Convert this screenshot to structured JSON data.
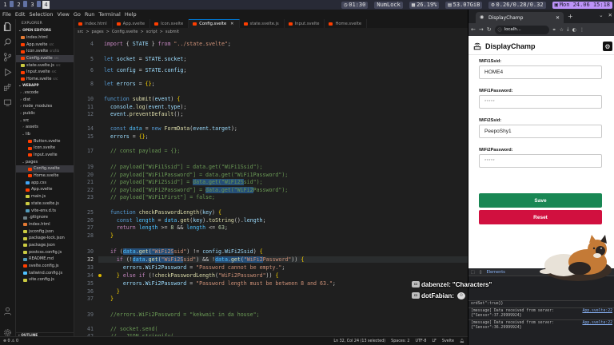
{
  "system_bar": {
    "workspaces": [
      "1",
      "2",
      "3",
      "4"
    ],
    "active_workspace": "4",
    "time_utc": "01:30",
    "numlock": "NumLock",
    "cpu": "26.19%",
    "disk": "53.07GiB",
    "load": "0.26/0.28/0.32",
    "clock": "Mon 24.06 15:18"
  },
  "vscode": {
    "menu": [
      "File",
      "Edit",
      "Selection",
      "View",
      "Go",
      "Run",
      "Terminal",
      "Help"
    ],
    "explorer": {
      "title": "EXPLORER",
      "open_editors_title": "OPEN EDITORS",
      "open_editors": [
        {
          "name": "index.html",
          "path": "",
          "color": "#e37933"
        },
        {
          "name": "App.svelte",
          "path": "src",
          "color": "#ff3e00"
        },
        {
          "name": "Icon.svelte",
          "path": "src/lib",
          "color": "#ff3e00"
        },
        {
          "name": "Config.svelte",
          "path": "src",
          "color": "#ff3e00",
          "selected": true
        },
        {
          "name": "state.svelte.js",
          "path": "src",
          "color": "#cbcb41"
        },
        {
          "name": "Input.svelte",
          "path": "src",
          "color": "#ff3e00"
        },
        {
          "name": "Home.svelte",
          "path": "src",
          "color": "#ff3e00"
        }
      ],
      "project_title": "WEBAPP",
      "tree": [
        {
          "name": ".vscode",
          "indent": 1,
          "folder": true
        },
        {
          "name": "dist",
          "indent": 1,
          "folder": true
        },
        {
          "name": "node_modules",
          "indent": 1,
          "folder": true
        },
        {
          "name": "public",
          "indent": 1,
          "folder": true
        },
        {
          "name": "src",
          "indent": 1,
          "folder": true,
          "open": true
        },
        {
          "name": "assets",
          "indent": 2,
          "folder": true
        },
        {
          "name": "lib",
          "indent": 2,
          "folder": true,
          "open": true
        },
        {
          "name": "Button.svelte",
          "indent": 3,
          "color": "#ff3e00"
        },
        {
          "name": "Icon.svelte",
          "indent": 3,
          "color": "#ff3e00"
        },
        {
          "name": "Input.svelte",
          "indent": 3,
          "color": "#ff3e00"
        },
        {
          "name": "pages",
          "indent": 2,
          "folder": true,
          "open": true
        },
        {
          "name": "Config.svelte",
          "indent": 3,
          "color": "#ff3e00",
          "selected": true
        },
        {
          "name": "Home.svelte",
          "indent": 3,
          "color": "#ff3e00"
        },
        {
          "name": "app.css",
          "indent": 2,
          "color": "#42a5f5"
        },
        {
          "name": "App.svelte",
          "indent": 2,
          "color": "#ff3e00"
        },
        {
          "name": "main.js",
          "indent": 2,
          "color": "#cbcb41"
        },
        {
          "name": "state.svelte.js",
          "indent": 2,
          "color": "#cbcb41"
        },
        {
          "name": "vite-env.d.ts",
          "indent": 2,
          "color": "#519aba"
        },
        {
          "name": ".gitignore",
          "indent": 1,
          "color": "#6d8086"
        },
        {
          "name": "index.html",
          "indent": 1,
          "color": "#e37933"
        },
        {
          "name": "jsconfig.json",
          "indent": 1,
          "color": "#cbcb41"
        },
        {
          "name": "package-lock.json",
          "indent": 1,
          "color": "#cbcb41"
        },
        {
          "name": "package.json",
          "indent": 1,
          "color": "#cbcb41"
        },
        {
          "name": "postcss.config.js",
          "indent": 1,
          "color": "#cbcb41"
        },
        {
          "name": "README.md",
          "indent": 1,
          "color": "#519aba"
        },
        {
          "name": "svelte.config.js",
          "indent": 1,
          "color": "#ff3e00"
        },
        {
          "name": "tailwind.config.js",
          "indent": 1,
          "color": "#4fc1ff"
        },
        {
          "name": "vite.config.js",
          "indent": 1,
          "color": "#cbcb41"
        }
      ],
      "outline_title": "OUTLINE",
      "timeline_title": "TIMELINE"
    },
    "tabs": [
      {
        "label": "index.html",
        "active": false
      },
      {
        "label": "App.svelte",
        "active": false
      },
      {
        "label": "Icon.svelte",
        "active": false
      },
      {
        "label": "Config.svelte",
        "active": true
      },
      {
        "label": "state.svelte.js",
        "active": false
      },
      {
        "label": "Input.svelte",
        "active": false
      },
      {
        "label": "Home.svelte",
        "active": false
      }
    ],
    "breadcrumbs": [
      "src",
      ">",
      "pages",
      ">",
      "Config.svelte",
      ">",
      "script",
      ">",
      "submit"
    ],
    "status": {
      "position": "Ln 32, Col 24 (13 selected)",
      "spaces": "Spaces: 2",
      "encoding": "UTF-8",
      "eol": "LF",
      "language": "Svelte"
    }
  },
  "browser": {
    "tab_title": "DisplayChamp",
    "url": "localh...",
    "app_title": "DisplayChamp",
    "fields": [
      {
        "label": "WiFi1Ssid:",
        "value": "HOME4",
        "password": false
      },
      {
        "label": "WiFi1Password:",
        "value": "*****",
        "password": true
      },
      {
        "label": "WiFi2Ssid:",
        "value": "PeepoShy1",
        "password": false
      },
      {
        "label": "WiFi2Password:",
        "value": "*****",
        "password": true
      }
    ],
    "save_label": "Save",
    "reset_label": "Reset",
    "devtools": {
      "elements_tab": "Elements",
      "console_rows": [
        {
          "text": "ordSet\":true}}",
          "source": ""
        },
        {
          "text": "[message] Data received from server: {\"Sensor\":37.29999924}",
          "source": "App.svelte:22"
        },
        {
          "text": "[message] Data received from server: {\"Sensor\":36.29999924}",
          "source": "App.svelte:22"
        }
      ]
    }
  },
  "stream_chat": [
    {
      "user": "dabenzel:",
      "message": "\"Characters\"",
      "user_color": "#ffffff",
      "emote": false
    },
    {
      "user": "dotFabian:",
      "message": "",
      "user_color": "#ffffff",
      "emote": true
    }
  ]
}
